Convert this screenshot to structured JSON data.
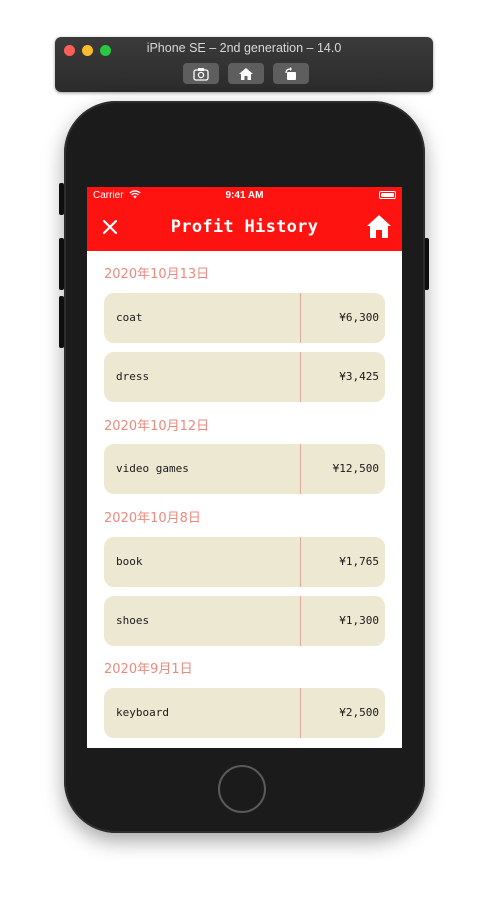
{
  "simulator": {
    "title": "iPhone SE – 2nd generation – 14.0",
    "buttons": [
      "screenshot-icon",
      "home-icon",
      "rotate-icon"
    ]
  },
  "status_bar": {
    "carrier": "Carrier",
    "time": "9:41 AM"
  },
  "nav": {
    "title": "Profit History",
    "close_icon": "close-icon",
    "home_icon": "home-icon"
  },
  "colors": {
    "accent": "#fe1311",
    "row_bg": "#ede8d2",
    "date_text": "#e98a7f",
    "divider": "#e0a89a"
  },
  "sections": [
    {
      "date": "2020年10月13日",
      "items": [
        {
          "name": "coat",
          "amount": "¥6,300"
        },
        {
          "name": "dress",
          "amount": "¥3,425"
        }
      ]
    },
    {
      "date": "2020年10月12日",
      "items": [
        {
          "name": "video games",
          "amount": "¥12,500"
        }
      ]
    },
    {
      "date": "2020年10月8日",
      "items": [
        {
          "name": "book",
          "amount": "¥1,765"
        },
        {
          "name": "shoes",
          "amount": "¥1,300"
        }
      ]
    },
    {
      "date": "2020年9月1日",
      "items": [
        {
          "name": "keyboard",
          "amount": "¥2,500"
        }
      ]
    }
  ]
}
